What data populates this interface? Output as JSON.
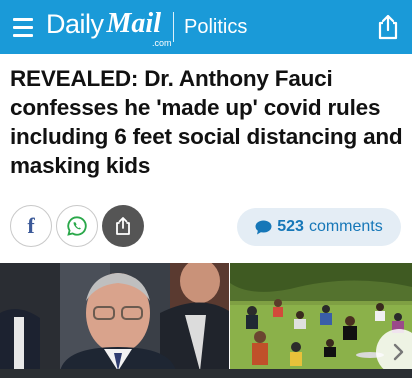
{
  "header": {
    "menu_icon": "hamburger-menu-icon",
    "brand_daily": "Daily",
    "brand_mail": "Mail",
    "brand_com": ".com",
    "section": "Politics",
    "share_icon": "share-upload-icon",
    "background_color": "#1a9ad8"
  },
  "article": {
    "headline": "REVEALED: Dr. Anthony Fauci confesses he 'made up' covid rules including 6 feet social distancing and masking kids"
  },
  "share_bar": {
    "facebook_glyph": "f",
    "facebook_icon": "facebook-icon",
    "whatsapp_icon": "whatsapp-icon",
    "share_icon": "share-icon",
    "comments_count": "523",
    "comments_label": "comments",
    "comments_icon": "speech-bubble-icon",
    "accent_color": "#1677b8"
  },
  "gallery": {
    "next_icon": "chevron-right-icon"
  }
}
